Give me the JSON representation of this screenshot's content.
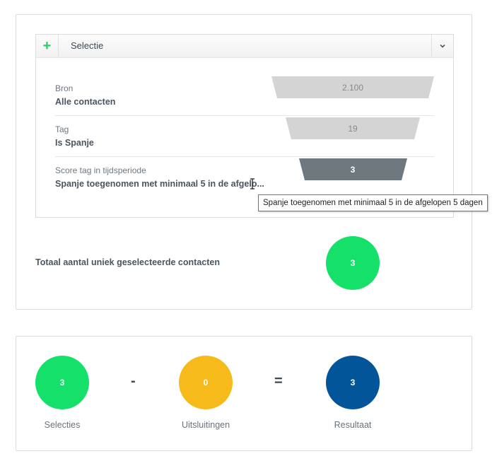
{
  "selection": {
    "title": "Selectie",
    "add_icon": "plus-icon",
    "collapse_icon": "chevron-down-icon",
    "rows": [
      {
        "label": "Bron",
        "value": "Alle contacten",
        "count": "2.100",
        "funnel_color": "#d4d4d4",
        "count_color": "#888888"
      },
      {
        "label": "Tag",
        "value": "Is Spanje",
        "count": "19",
        "funnel_color": "#d4d4d4",
        "count_color": "#888888"
      },
      {
        "label": "Score tag in tijdsperiode",
        "value": "Spanje toegenomen met minimaal 5 in de afgelo...",
        "count": "3",
        "funnel_color": "#6f787f",
        "count_color": "#ffffff"
      }
    ]
  },
  "total": {
    "label": "Totaal aantal uniek geselecteerde contacten",
    "count": "3",
    "color": "#15e16a"
  },
  "tooltip": {
    "text": "Spanje toegenomen met minimaal 5 in de afgelopen 5 dagen"
  },
  "summary": {
    "selections": {
      "count": "3",
      "label": "Selecties",
      "color": "#15e16a"
    },
    "minus": "-",
    "exclusions": {
      "count": "0",
      "label": "Uitsluitingen",
      "color": "#f6ba1b"
    },
    "equals": "=",
    "result": {
      "count": "3",
      "label": "Resultaat",
      "color": "#015598"
    }
  }
}
